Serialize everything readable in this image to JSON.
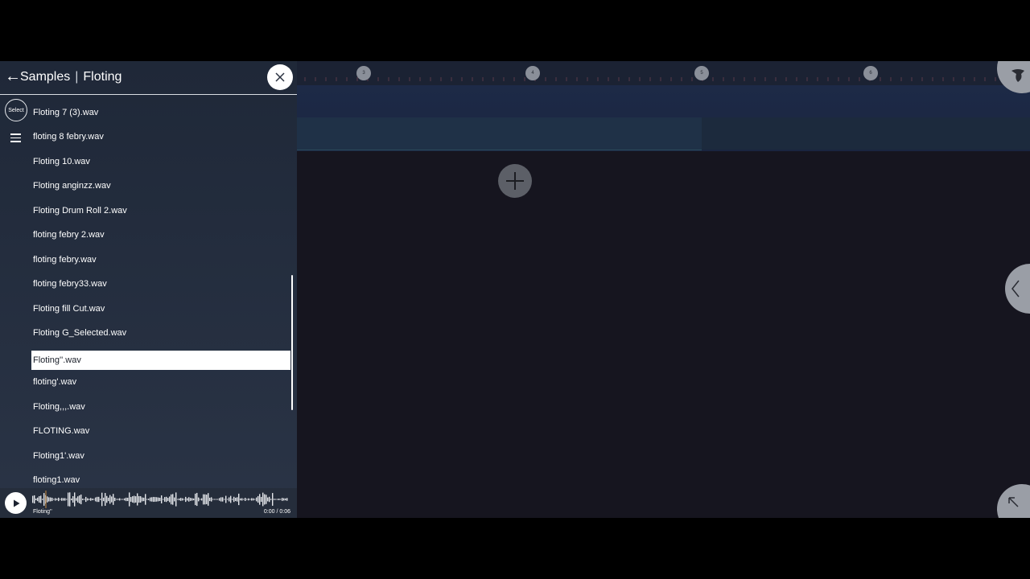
{
  "browser": {
    "back_symbol": "←",
    "title_primary": "Samples",
    "title_separator": "|",
    "title_secondary": "Floting",
    "select_label": "Select",
    "files": [
      {
        "name": "Floting 7  (3).wav",
        "selected": false
      },
      {
        "name": "floting 8 febry.wav",
        "selected": false
      },
      {
        "name": "Floting 10.wav",
        "selected": false
      },
      {
        "name": "Floting anginzz.wav",
        "selected": false
      },
      {
        "name": "Floting Drum Roll 2.wav",
        "selected": false
      },
      {
        "name": "floting febry 2.wav",
        "selected": false
      },
      {
        "name": "floting febry.wav",
        "selected": false
      },
      {
        "name": "floting febry33.wav",
        "selected": false
      },
      {
        "name": "Floting fill Cut.wav",
        "selected": false
      },
      {
        "name": "Floting G_Selected.wav",
        "selected": false
      },
      {
        "name": "Floting''.wav",
        "selected": true
      },
      {
        "name": "floting'.wav",
        "selected": false
      },
      {
        "name": "Floting,,,.wav",
        "selected": false
      },
      {
        "name": "FLOTING.wav",
        "selected": false
      },
      {
        "name": "Floting1'.wav",
        "selected": false
      },
      {
        "name": "floting1.wav",
        "selected": false
      }
    ]
  },
  "preview": {
    "name": "Floting''",
    "time": "0:00 / 0:06"
  },
  "timeline": {
    "markers": [
      "3",
      "4",
      "5",
      "6"
    ]
  },
  "icons": {
    "close": "close-icon",
    "menu": "menu-icon",
    "play": "play-icon",
    "add": "plus-icon",
    "collapse": "chevron-left-icon",
    "expand": "arrow-up-left-icon",
    "mascot": "fruit-logo-icon"
  },
  "colors": {
    "panel_bg": "#1f2838",
    "workspace_bg": "#16151f",
    "track_bg": "#1d2a47",
    "selected_row": "#ffffff"
  }
}
